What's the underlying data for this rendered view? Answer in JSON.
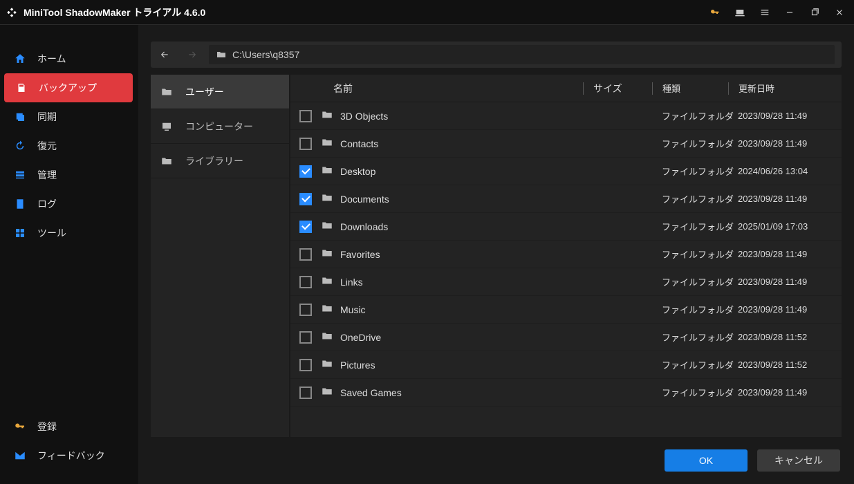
{
  "titlebar": {
    "title": "MiniTool ShadowMaker トライアル 4.6.0"
  },
  "sidebar": {
    "items": [
      {
        "label": "ホーム"
      },
      {
        "label": "バックアップ"
      },
      {
        "label": "同期"
      },
      {
        "label": "復元"
      },
      {
        "label": "管理"
      },
      {
        "label": "ログ"
      },
      {
        "label": "ツール"
      }
    ],
    "bottom": [
      {
        "label": "登録"
      },
      {
        "label": "フィードバック"
      }
    ]
  },
  "pathbar": {
    "path": "C:\\Users\\q8357"
  },
  "tree": {
    "items": [
      {
        "label": "ユーザー"
      },
      {
        "label": "コンピューター"
      },
      {
        "label": "ライブラリー"
      }
    ],
    "active": 0
  },
  "columns": {
    "name": "名前",
    "size": "サイズ",
    "type": "種類",
    "date": "更新日時"
  },
  "rows": [
    {
      "checked": false,
      "name": "3D Objects",
      "type": "ファイルフォルダ",
      "date": "2023/09/28 11:49"
    },
    {
      "checked": false,
      "name": "Contacts",
      "type": "ファイルフォルダ",
      "date": "2023/09/28 11:49"
    },
    {
      "checked": true,
      "name": "Desktop",
      "type": "ファイルフォルダ",
      "date": "2024/06/26 13:04"
    },
    {
      "checked": true,
      "name": "Documents",
      "type": "ファイルフォルダ",
      "date": "2023/09/28 11:49"
    },
    {
      "checked": true,
      "name": "Downloads",
      "type": "ファイルフォルダ",
      "date": "2025/01/09 17:03"
    },
    {
      "checked": false,
      "name": "Favorites",
      "type": "ファイルフォルダ",
      "date": "2023/09/28 11:49"
    },
    {
      "checked": false,
      "name": "Links",
      "type": "ファイルフォルダ",
      "date": "2023/09/28 11:49"
    },
    {
      "checked": false,
      "name": "Music",
      "type": "ファイルフォルダ",
      "date": "2023/09/28 11:49"
    },
    {
      "checked": false,
      "name": "OneDrive",
      "type": "ファイルフォルダ",
      "date": "2023/09/28 11:52"
    },
    {
      "checked": false,
      "name": "Pictures",
      "type": "ファイルフォルダ",
      "date": "2023/09/28 11:52"
    },
    {
      "checked": false,
      "name": "Saved Games",
      "type": "ファイルフォルダ",
      "date": "2023/09/28 11:49"
    }
  ],
  "footer": {
    "ok": "OK",
    "cancel": "キャンセル"
  }
}
